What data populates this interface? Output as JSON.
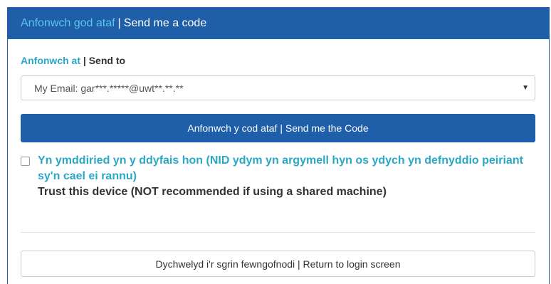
{
  "header": {
    "title_welsh": "Anfonwch god ataf",
    "separator": "|",
    "title_english": "Send me a code"
  },
  "send_to": {
    "label_welsh": "Anfonwch at",
    "label_rest": "| Send to",
    "selected_option": "My Email: gar***.*****@uwt**.**.**",
    "arrow_glyph": "▼"
  },
  "send_button": {
    "label": "Anfonwch y cod ataf | Send me the Code"
  },
  "trust_device": {
    "checked": false,
    "label_welsh": "Yn ymddiried yn y ddyfais hon (NID ydym yn argymell hyn os ydych yn defnyddio peiriant sy'n cael ei rannu)",
    "label_english": "Trust this device (NOT recommended if using a shared machine)"
  },
  "return_button": {
    "label": "Dychwelyd i'r sgrin fewngofnodi | Return to login screen"
  },
  "colors": {
    "primary": "#1f5ea8",
    "accent_text": "#2aa8c6",
    "header_accent": "#5bc8e8"
  }
}
